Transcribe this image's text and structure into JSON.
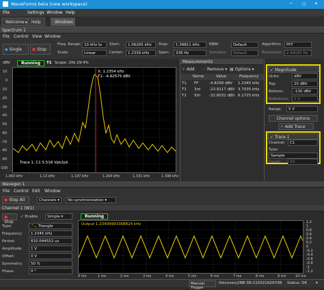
{
  "app": {
    "title": "WaveForms beta (new workspace)"
  },
  "menu": [
    "File",
    "Settings",
    "Window",
    "Help"
  ],
  "tabs": [
    "Welcome",
    "Help",
    "Windows"
  ],
  "spectrum": {
    "panel_title": "Spectrum 1",
    "menu": [
      "File",
      "Control",
      "View",
      "Window"
    ],
    "single": "Single",
    "stop": "Stop",
    "freq_range_lbl": "Freq. Range:",
    "freq_range_val": "10 kHz to",
    "scale_lbl": "Scale:",
    "scale_val": "Linear",
    "start_lbl": "Start:",
    "start_val": "1.06265 kHz",
    "center_lbl": "Center:",
    "center_val": "1.2339 kHz",
    "stop_lbl": "Stop:",
    "stop_val": "1.39811 kHz",
    "span_lbl": "Span:",
    "span_val": "336 Hz",
    "rbw_lbl": "RBW:",
    "rbw_val": "Default",
    "samples_lbl": "Samples:",
    "samples_val": "Default",
    "algo_lbl": "Algorithm:",
    "algo_val": "FFT",
    "res_lbl": "Resolution:",
    "res_val": "2.44141 Hz",
    "status": "Running",
    "scope_info": "Scope: 20k 29.4%",
    "unit": "dBV",
    "cursor_x": "X: 1.2354 kHz",
    "cursor_t": "T1: -4.82575 dBV",
    "trace_label": "Trace 1: C1 5.518 Vpk2pk",
    "x_ticks": [
      "1.063 kHz",
      "1.13 kHz",
      "1.197 kHz",
      "1.264 kHz",
      "1.331 kHz",
      "1.398 kHz"
    ],
    "y_ticks": [
      "10",
      "0",
      "-10",
      "-20",
      "-30",
      "-40",
      "-50",
      "-60",
      "-70",
      "-80",
      "-90",
      "-100"
    ]
  },
  "measurements": {
    "title": "Measurements",
    "add": "Add",
    "remove": "Remove",
    "options": "Options",
    "headers": [
      "Name",
      "Value",
      "Frequency"
    ],
    "rows": [
      [
        "T1",
        "FF",
        "-4.8258 dBV",
        "1.2345 kHz"
      ],
      [
        "T1",
        "3rd",
        "-23.9117 dBV",
        "3.7035 kHz"
      ],
      [
        "T1",
        "5th",
        "-32.8031 dBV",
        "6.1725 kHz"
      ]
    ]
  },
  "magnitude": {
    "title": "Magnitude",
    "units_lbl": "Units:",
    "units_val": "dBV",
    "top_lbl": "Top:",
    "top_val": "20 dBV",
    "bottom_lbl": "Bottom:",
    "bottom_val": "-130 dBV",
    "ref_lbl": "Reference:",
    "ref_val": "1 V",
    "range_lbl": "Range:",
    "range_val": "5 V",
    "channel_options": "Channel options",
    "add_trace": "Add Trace"
  },
  "trace": {
    "title": "Trace 1",
    "channel_lbl": "Channel:",
    "channel_val": "C1",
    "type_lbl": "Type:",
    "type_val": "Sample",
    "count_lbl": "Count:",
    "count_val": "10"
  },
  "wavegen": {
    "panel_title": "Wavegen 1",
    "menu": [
      "File",
      "Control",
      "Edit",
      "Window"
    ],
    "stop_all": "Stop All",
    "channels": "Channels",
    "sync": "No synchronization",
    "channel_title": "Channel 1 (W1)",
    "stop": "Stop",
    "enable": "Enable",
    "mode": "Simple",
    "params": [
      [
        "Type:",
        "Triangle"
      ],
      [
        "Frequency:",
        "1.2345 kHz"
      ],
      [
        "Period:",
        "810.044552 us"
      ],
      [
        "Amplitude:",
        "1 V"
      ],
      [
        "Offset:",
        "0 V"
      ],
      [
        "Symmetry:",
        "50 %"
      ],
      [
        "Phase:",
        "0 °"
      ]
    ],
    "status": "Running",
    "output": "Output 1.23499993368824 kHz",
    "x_ticks": [
      "0 ms",
      "1 ms",
      "2 ms",
      "3 ms",
      "4 ms",
      "5 ms",
      "6 ms",
      "7 ms",
      "8 ms",
      "9 ms",
      "10 ms"
    ],
    "y_ticks": [
      "1.2",
      "1",
      "0.8",
      "0.6",
      "0.4",
      "0.2",
      "0",
      "-0.2",
      "-0.4",
      "-0.6",
      "-0.8",
      "-1",
      "-1.2"
    ]
  },
  "statusbar": {
    "trigger": "Manual Trigger",
    "device": "Discovery2NB SN:210321A2A708",
    "status": "Status: OK"
  }
}
